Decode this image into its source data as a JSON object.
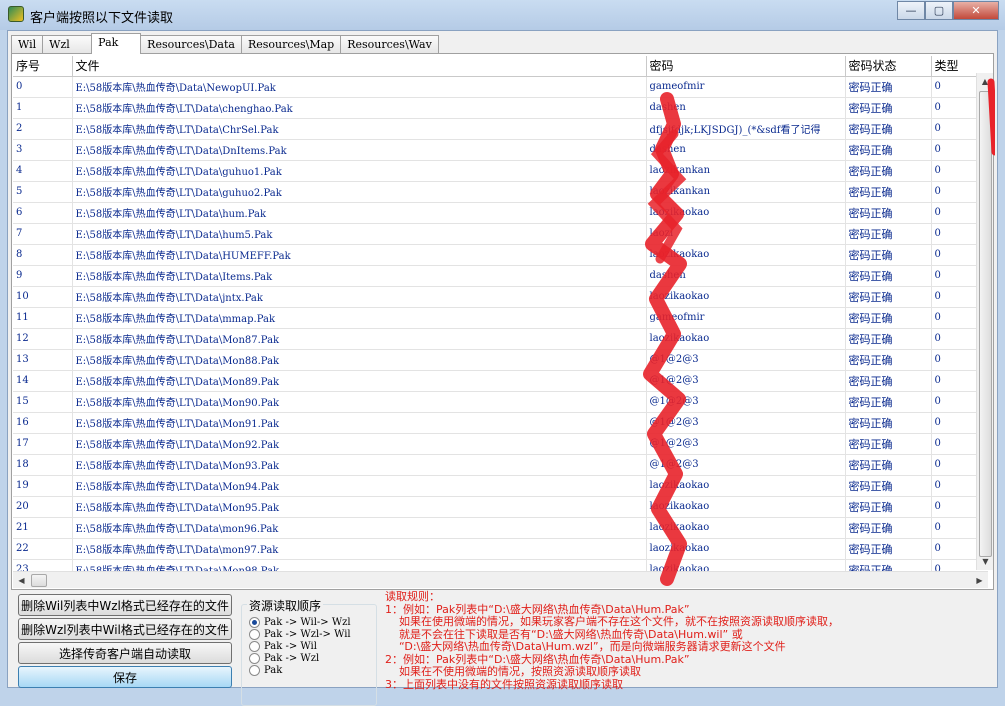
{
  "window": {
    "title": "客户端按照以下文件读取",
    "minimize_glyph": "—",
    "maximize_glyph": "▢",
    "close_glyph": "✕",
    "icon": "app-logo-icon"
  },
  "tabs": [
    {
      "label": "Wil"
    },
    {
      "label": "Wzl"
    },
    {
      "label": "Pak"
    },
    {
      "label": "Resources\\Data"
    },
    {
      "label": "Resources\\Map"
    },
    {
      "label": "Resources\\Wav"
    }
  ],
  "active_tab": "Pak",
  "table": {
    "columns": [
      "序号",
      "文件",
      "密码",
      "密码状态",
      "类型"
    ],
    "rows": [
      {
        "index": "0",
        "file": "E:\\58版本库\\热血传奇\\Data\\NewopUI.Pak",
        "password": "gameofmir",
        "status": "密码正确",
        "type": "0"
      },
      {
        "index": "1",
        "file": "E:\\58版本库\\热血传奇\\LT\\Data\\chenghao.Pak",
        "password": "dashen",
        "status": "密码正确",
        "type": "0"
      },
      {
        "index": "2",
        "file": "E:\\58版本库\\热血传奇\\LT\\Data\\ChrSel.Pak",
        "password": "dfjsjfdjk;LKJSDGJ)_(*&sdf看了记得",
        "status": "密码正确",
        "type": "0"
      },
      {
        "index": "3",
        "file": "E:\\58版本库\\热血传奇\\LT\\Data\\DnItems.Pak",
        "password": "dashen",
        "status": "密码正确",
        "type": "0"
      },
      {
        "index": "4",
        "file": "E:\\58版本库\\热血传奇\\LT\\Data\\guhuo1.Pak",
        "password": "laozikankan",
        "status": "密码正确",
        "type": "0"
      },
      {
        "index": "5",
        "file": "E:\\58版本库\\热血传奇\\LT\\Data\\guhuo2.Pak",
        "password": "laozikankan",
        "status": "密码正确",
        "type": "0"
      },
      {
        "index": "6",
        "file": "E:\\58版本库\\热血传奇\\LT\\Data\\hum.Pak",
        "password": "laozikaokao",
        "status": "密码正确",
        "type": "0"
      },
      {
        "index": "7",
        "file": "E:\\58版本库\\热血传奇\\LT\\Data\\hum5.Pak",
        "password": "laozi",
        "status": "密码正确",
        "type": "0"
      },
      {
        "index": "8",
        "file": "E:\\58版本库\\热血传奇\\LT\\Data\\HUMEFF.Pak",
        "password": "laozikaokao",
        "status": "密码正确",
        "type": "0"
      },
      {
        "index": "9",
        "file": "E:\\58版本库\\热血传奇\\LT\\Data\\Items.Pak",
        "password": "dashen",
        "status": "密码正确",
        "type": "0"
      },
      {
        "index": "10",
        "file": "E:\\58版本库\\热血传奇\\LT\\Data\\jntx.Pak",
        "password": "laozikaokao",
        "status": "密码正确",
        "type": "0"
      },
      {
        "index": "11",
        "file": "E:\\58版本库\\热血传奇\\LT\\Data\\mmap.Pak",
        "password": "gameofmir",
        "status": "密码正确",
        "type": "0"
      },
      {
        "index": "12",
        "file": "E:\\58版本库\\热血传奇\\LT\\Data\\Mon87.Pak",
        "password": "laozikaokao",
        "status": "密码正确",
        "type": "0"
      },
      {
        "index": "13",
        "file": "E:\\58版本库\\热血传奇\\LT\\Data\\Mon88.Pak",
        "password": "@1@2@3",
        "status": "密码正确",
        "type": "0"
      },
      {
        "index": "14",
        "file": "E:\\58版本库\\热血传奇\\LT\\Data\\Mon89.Pak",
        "password": "@1@2@3",
        "status": "密码正确",
        "type": "0"
      },
      {
        "index": "15",
        "file": "E:\\58版本库\\热血传奇\\LT\\Data\\Mon90.Pak",
        "password": "@1@2@3",
        "status": "密码正确",
        "type": "0"
      },
      {
        "index": "16",
        "file": "E:\\58版本库\\热血传奇\\LT\\Data\\Mon91.Pak",
        "password": "@1@2@3",
        "status": "密码正确",
        "type": "0"
      },
      {
        "index": "17",
        "file": "E:\\58版本库\\热血传奇\\LT\\Data\\Mon92.Pak",
        "password": "@1@2@3",
        "status": "密码正确",
        "type": "0"
      },
      {
        "index": "18",
        "file": "E:\\58版本库\\热血传奇\\LT\\Data\\Mon93.Pak",
        "password": "@1@2@3",
        "status": "密码正确",
        "type": "0"
      },
      {
        "index": "19",
        "file": "E:\\58版本库\\热血传奇\\LT\\Data\\Mon94.Pak",
        "password": "laozikaokao",
        "status": "密码正确",
        "type": "0"
      },
      {
        "index": "20",
        "file": "E:\\58版本库\\热血传奇\\LT\\Data\\Mon95.Pak",
        "password": "laozikaokao",
        "status": "密码正确",
        "type": "0"
      },
      {
        "index": "21",
        "file": "E:\\58版本库\\热血传奇\\LT\\Data\\mon96.Pak",
        "password": "laozikaokao",
        "status": "密码正确",
        "type": "0"
      },
      {
        "index": "22",
        "file": "E:\\58版本库\\热血传奇\\LT\\Data\\mon97.Pak",
        "password": "laozikaokao",
        "status": "密码正确",
        "type": "0"
      },
      {
        "index": "23",
        "file": "E:\\58版本库\\热血传奇\\LT\\Data\\Mon98.Pak",
        "password": "laozikaokao",
        "status": "密码正确",
        "type": "0"
      }
    ]
  },
  "buttons": {
    "delete_wil": "删除Wil列表中Wzl格式已经存在的文件",
    "delete_wzl": "删除Wzl列表中Wil格式已经存在的文件",
    "auto_read": "选择传奇客户端自动读取",
    "save": "保存"
  },
  "resource_order": {
    "title": "资源读取顺序",
    "options": [
      "Pak -> Wil-> Wzl",
      "Pak -> Wzl-> Wil",
      "Pak -> Wil",
      "Pak -> Wzl",
      "Pak"
    ],
    "selected": "Pak -> Wil-> Wzl"
  },
  "rules": [
    "读取规则：",
    "1：例如：Pak列表中“D:\\盛大网络\\热血传奇\\Data\\Hum.Pak”",
    "    如果在使用微端的情况，如果玩家客户端不存在这个文件，就不在按照资源读取顺序读取，",
    "    就是不会在往下读取是否有“D:\\盛大网络\\热血传奇\\Data\\Hum.wil” 或",
    "    “D:\\盛大网络\\热血传奇\\Data\\Hum.wzl”，而是向微端服务器请求更新这个文件",
    "2：例如：Pak列表中“D:\\盛大网络\\热血传奇\\Data\\Hum.Pak”",
    "    如果在不使用微端的情况，按照资源读取顺序读取",
    "3：上面列表中没有的文件按照资源读取顺序读取"
  ],
  "colors": {
    "row_text": "#0a2a8f",
    "rules_text": "#e0201a",
    "scribble": "#e8222a"
  }
}
